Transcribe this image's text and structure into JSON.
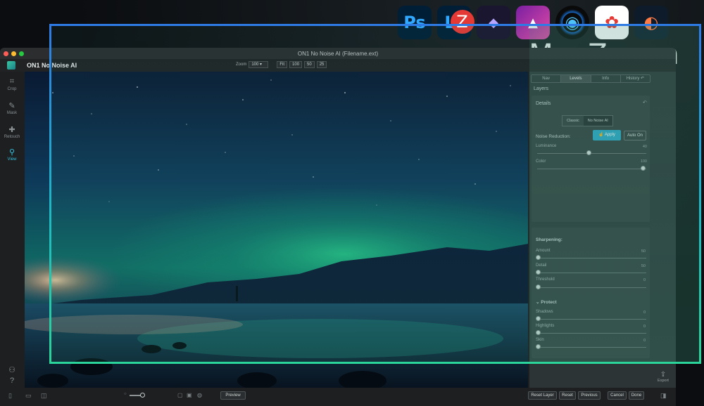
{
  "promo": {
    "watermark_mark": "Z",
    "watermark_text": "www.MacZ.com",
    "apps": [
      {
        "name": "photoshop-icon",
        "label": "Ps"
      },
      {
        "name": "lightroom-icon",
        "label": "Lr"
      },
      {
        "name": "darkroom-icon",
        "label": ""
      },
      {
        "name": "affinity-photo-icon",
        "label": ""
      },
      {
        "name": "capture-one-icon",
        "label": ""
      },
      {
        "name": "apple-photos-icon",
        "label": ""
      },
      {
        "name": "pixelmator-icon",
        "label": ""
      }
    ]
  },
  "window": {
    "title": "ON1 No Noise AI (Filename.ext)"
  },
  "header": {
    "app_name": "ON1 No Noise AI",
    "zoom_label": "Zoom",
    "zoom_value": "100",
    "zoom_buttons": [
      "Fit",
      "100",
      "50",
      "25"
    ]
  },
  "left_tools": [
    {
      "name": "crop",
      "label": "Crop",
      "active": false
    },
    {
      "name": "mask",
      "label": "Mask",
      "active": false
    },
    {
      "name": "retouch",
      "label": "Retouch",
      "active": false
    },
    {
      "name": "view",
      "label": "View",
      "active": true
    }
  ],
  "panel": {
    "tabs": [
      "Nav",
      "Levels",
      "Info",
      "History"
    ],
    "active_tab": "Levels",
    "layers_label": "Layers",
    "details_label": "Details",
    "mode_options": [
      "Classic",
      "No Noise AI"
    ],
    "mode_selected": "No Noise AI",
    "noise_reduction_label": "Noise Reduction:",
    "apply_label": "Apply",
    "auto_on_label": "Auto On",
    "sliders_nr": [
      {
        "label": "Luminance",
        "value": "40",
        "level": 0.4
      },
      {
        "label": "Color",
        "value": "100",
        "level": 1.0
      }
    ],
    "sharpening_label": "Sharpening:",
    "sliders_sharp": [
      {
        "label": "Amount",
        "value": "50",
        "level": 0.0
      },
      {
        "label": "Detail",
        "value": "50",
        "level": 0.0
      },
      {
        "label": "Threshold",
        "value": "0",
        "level": 0.0
      }
    ],
    "protect_label": "Protect",
    "sliders_protect": [
      {
        "label": "Shadows",
        "value": "0",
        "level": 0.0
      },
      {
        "label": "Highlights",
        "value": "0",
        "level": 0.0
      },
      {
        "label": "Skin",
        "value": "0",
        "level": 0.0
      }
    ]
  },
  "bottom": {
    "preview_label": "Preview",
    "reset_layer_label": "Reset Layer",
    "reset_label": "Reset",
    "previous_label": "Previous",
    "cancel_label": "Cancel",
    "done_label": "Done",
    "export_label": "Export"
  },
  "colors": {
    "accent": "#35c1df",
    "apply": "#2aa5c7",
    "frame_top": "#2f7be6",
    "frame_bottom": "#2bd49a"
  }
}
